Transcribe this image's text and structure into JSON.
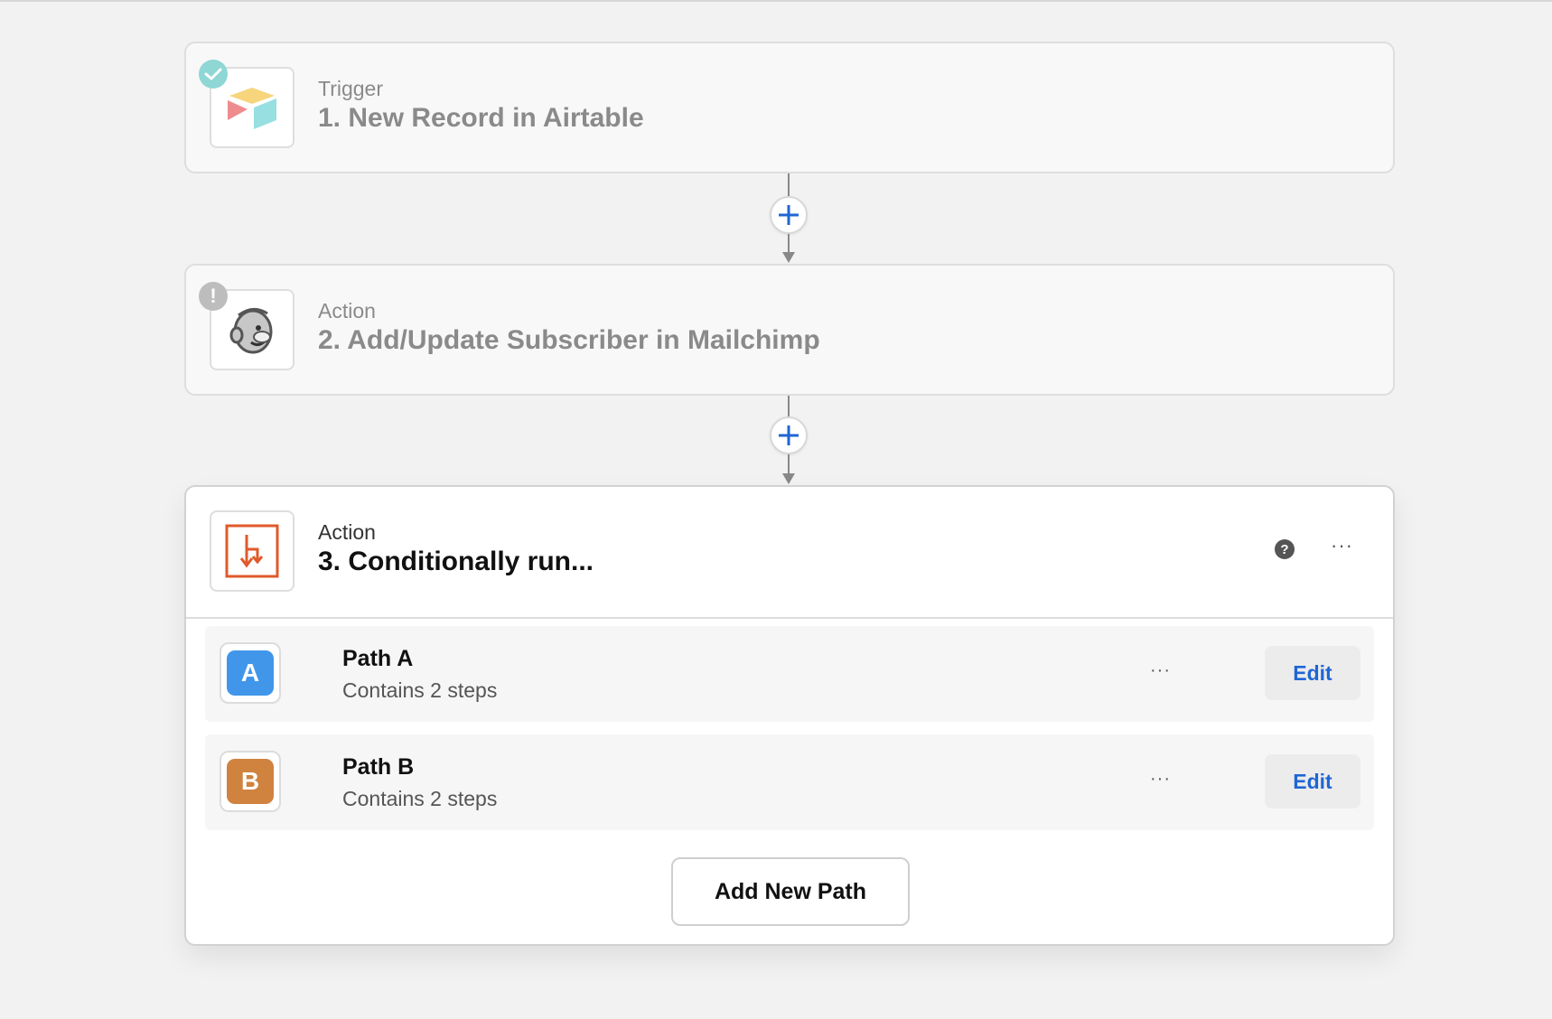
{
  "steps": [
    {
      "type": "Trigger",
      "title": "1. New Record in Airtable",
      "app_icon": "airtable-logo",
      "status_icon": "check-icon"
    },
    {
      "type": "Action",
      "title": "2. Add/Update Subscriber in Mailchimp",
      "app_icon": "mailchimp-logo",
      "status_icon": "warning-icon",
      "status_glyph": "!"
    },
    {
      "type": "Action",
      "title": "3. Conditionally run...",
      "app_icon": "paths-icon",
      "help_glyph": "?",
      "more_glyph": "···"
    }
  ],
  "paths": [
    {
      "badge": "A",
      "name": "Path A",
      "subtitle": "Contains 2 steps",
      "badge_color": "#4196ea",
      "more_glyph": "···",
      "edit_label": "Edit"
    },
    {
      "badge": "B",
      "name": "Path B",
      "subtitle": "Contains 2 steps",
      "badge_color": "#d0823f",
      "more_glyph": "···",
      "edit_label": "Edit"
    }
  ],
  "add_path_label": "Add New Path",
  "colors": {
    "accent": "#1f66d4",
    "paths_orange": "#e05a2b",
    "check": "#8ed7d5"
  }
}
